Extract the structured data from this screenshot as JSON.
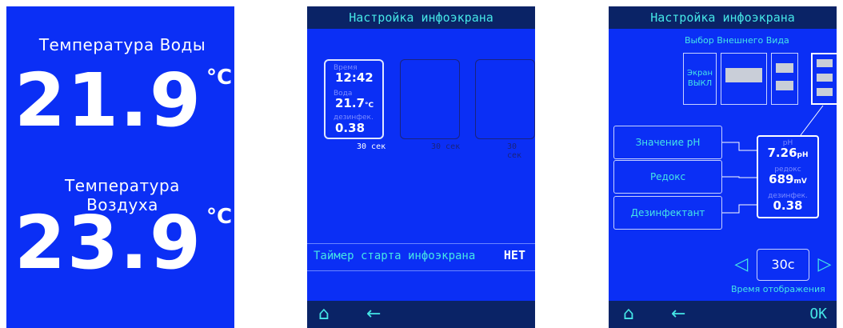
{
  "screen1": {
    "water": {
      "label": "Температура Воды",
      "value": "21.9",
      "unit": "°C"
    },
    "air": {
      "label": "Температура Воздуха",
      "value": "23.9",
      "unit": "°C"
    }
  },
  "screen2": {
    "title": "Настройка инфоэкрана",
    "slots": [
      {
        "time_label": "Время",
        "time_value": "12:42",
        "water_label": "Вода",
        "water_value": "21.7",
        "water_unit": "°C",
        "disinf_label": "дезинфек.",
        "disinf_value": "0.38",
        "duration": "30 сек"
      },
      {
        "duration": "30 сек"
      },
      {
        "duration": "30 сек"
      }
    ],
    "timer_label": "Таймер старта инфоэкрана",
    "timer_value": "НЕТ"
  },
  "screen3": {
    "title": "Настройка инфоэкрана",
    "subtitle": "Выбор Внешнего Вида",
    "screen_off_label": "Экран ВЫКЛ",
    "params": [
      "Значение pH",
      "Редокс",
      "Дезинфектант"
    ],
    "preview": {
      "ph_label": "pH",
      "ph_value": "7.26",
      "ph_unit": "pH",
      "redox_label": "редокс",
      "redox_value": "689",
      "redox_unit": "mV",
      "disinf_label": "дезинфек.",
      "disinf_value": "0.38"
    },
    "time_value": "30с",
    "time_caption": "Время отображения",
    "ok_label": "ОК"
  },
  "icons": {
    "home": "home-icon",
    "back": "back-arrow-icon",
    "prev": "triangle-left-icon",
    "next": "triangle-right-icon"
  },
  "colors": {
    "screen_bg": "#0b2ff5",
    "bar_bg": "#0a2366",
    "accent": "#45e6e6",
    "text": "#ffffff"
  }
}
